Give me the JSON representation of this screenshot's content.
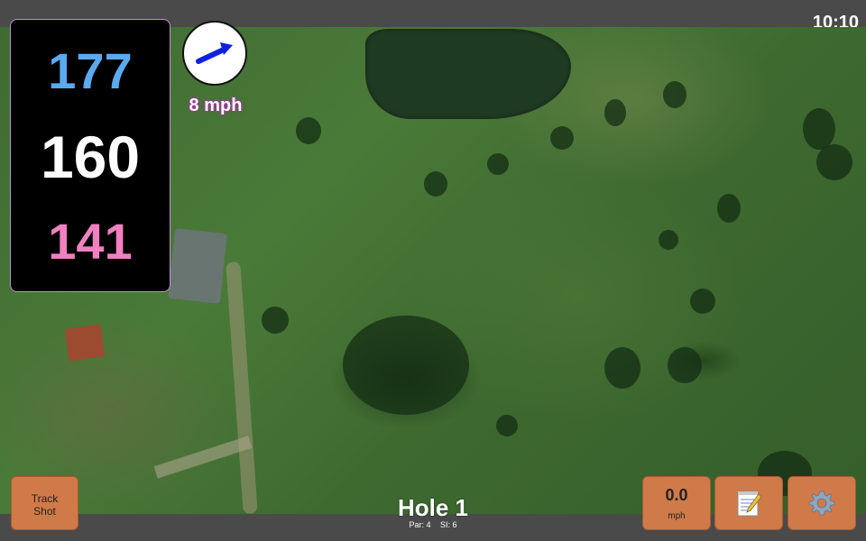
{
  "status_bar": {
    "time": "10:10"
  },
  "distances": {
    "back": "177",
    "middle": "160",
    "front": "141"
  },
  "wind": {
    "speed_label": "8 mph",
    "direction_icon": "wind-arrow-icon"
  },
  "track_shot": {
    "line1": "Track",
    "line2": "Shot"
  },
  "speed_button": {
    "value": "0.0",
    "unit": "mph"
  },
  "notes_button": {
    "icon": "notepad-icon"
  },
  "settings_button": {
    "icon": "gear-icon"
  },
  "hole": {
    "title": "Hole 1",
    "par": "Par: 4",
    "si": "SI: 6"
  },
  "colors": {
    "back": "#5aaaf0",
    "middle": "#ffffff",
    "front": "#f080c0",
    "button": "#d07a49",
    "wind_arrow": "#1020e0"
  }
}
